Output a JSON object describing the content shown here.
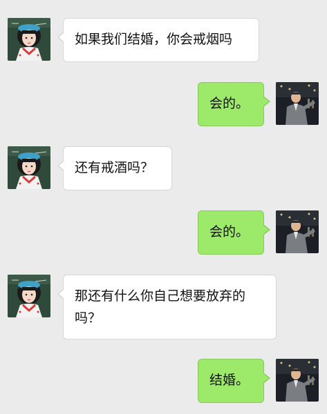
{
  "conversation": {
    "messages": [
      {
        "sender": "girl",
        "text": "如果我们结婚，你会戒烟吗"
      },
      {
        "sender": "boy",
        "text": "会的。"
      },
      {
        "sender": "girl",
        "text": "还有戒酒吗？"
      },
      {
        "sender": "boy",
        "text": "会的。"
      },
      {
        "sender": "girl",
        "text": "那还有什么你自己想要放弃的吗？"
      },
      {
        "sender": "boy",
        "text": "结婚。"
      }
    ]
  },
  "colors": {
    "background": "#ebebeb",
    "incoming_bubble": "#ffffff",
    "outgoing_bubble": "#9dea6a"
  },
  "icons": {
    "incoming_avatar": "girl-avatar-icon",
    "outgoing_avatar": "man-avatar-icon"
  }
}
